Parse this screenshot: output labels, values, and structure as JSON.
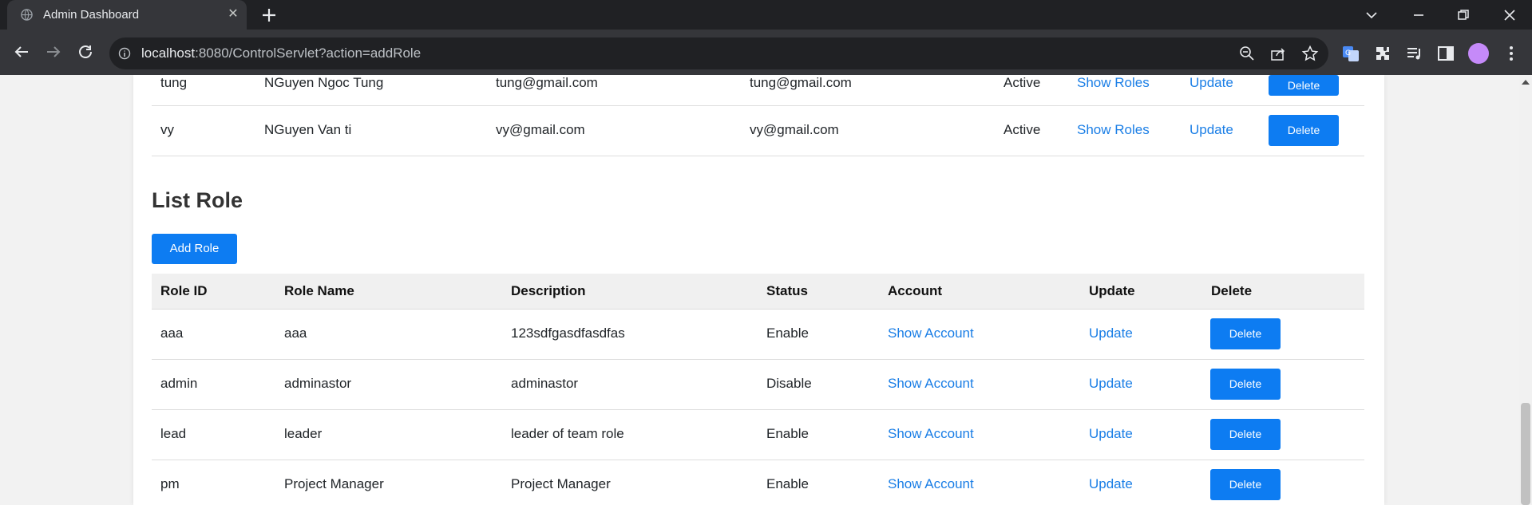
{
  "browser": {
    "tab_title": "Admin Dashboard",
    "url_host": "localhost",
    "url_rest": ":8080/ControlServlet?action=addRole"
  },
  "accounts": {
    "rows": [
      {
        "id": "tung",
        "name": "NGuyen Ngoc Tung",
        "email": "tung@gmail.com",
        "email2": "tung@gmail.com",
        "status": "Active",
        "show": "Show Roles",
        "update": "Update",
        "delete": "Delete"
      },
      {
        "id": "vy",
        "name": "NGuyen Van ti",
        "email": "vy@gmail.com",
        "email2": "vy@gmail.com",
        "status": "Active",
        "show": "Show Roles",
        "update": "Update",
        "delete": "Delete"
      }
    ]
  },
  "roles": {
    "heading": "List Role",
    "add_label": "Add Role",
    "headers": [
      "Role ID",
      "Role Name",
      "Description",
      "Status",
      "Account",
      "Update",
      "Delete"
    ],
    "rows": [
      {
        "id": "aaa",
        "name": "aaa",
        "desc": "123sdfgasdfasdfas",
        "status": "Enable",
        "show": "Show Account",
        "update": "Update",
        "delete": "Delete"
      },
      {
        "id": "admin",
        "name": "adminastor",
        "desc": "adminastor",
        "status": "Disable",
        "show": "Show Account",
        "update": "Update",
        "delete": "Delete"
      },
      {
        "id": "lead",
        "name": "leader",
        "desc": "leader of team role",
        "status": "Enable",
        "show": "Show Account",
        "update": "Update",
        "delete": "Delete"
      },
      {
        "id": "pm",
        "name": "Project Manager",
        "desc": "Project Manager",
        "status": "Enable",
        "show": "Show Account",
        "update": "Update",
        "delete": "Delete"
      }
    ]
  },
  "colors": {
    "primary": "#0d7cf2",
    "link": "#1a7ee6",
    "chrome_dark": "#202124",
    "chrome_tab": "#35363a"
  },
  "icons": [
    "globe-icon",
    "close-icon",
    "plus-icon",
    "chevron-down-icon",
    "minimize-icon",
    "restore-icon",
    "close-window-icon",
    "back-icon",
    "forward-icon",
    "reload-icon",
    "info-icon",
    "zoom-out-icon",
    "share-icon",
    "star-icon",
    "translate-icon",
    "extensions-icon",
    "media-icon",
    "side-panel-icon",
    "menu-icon"
  ]
}
